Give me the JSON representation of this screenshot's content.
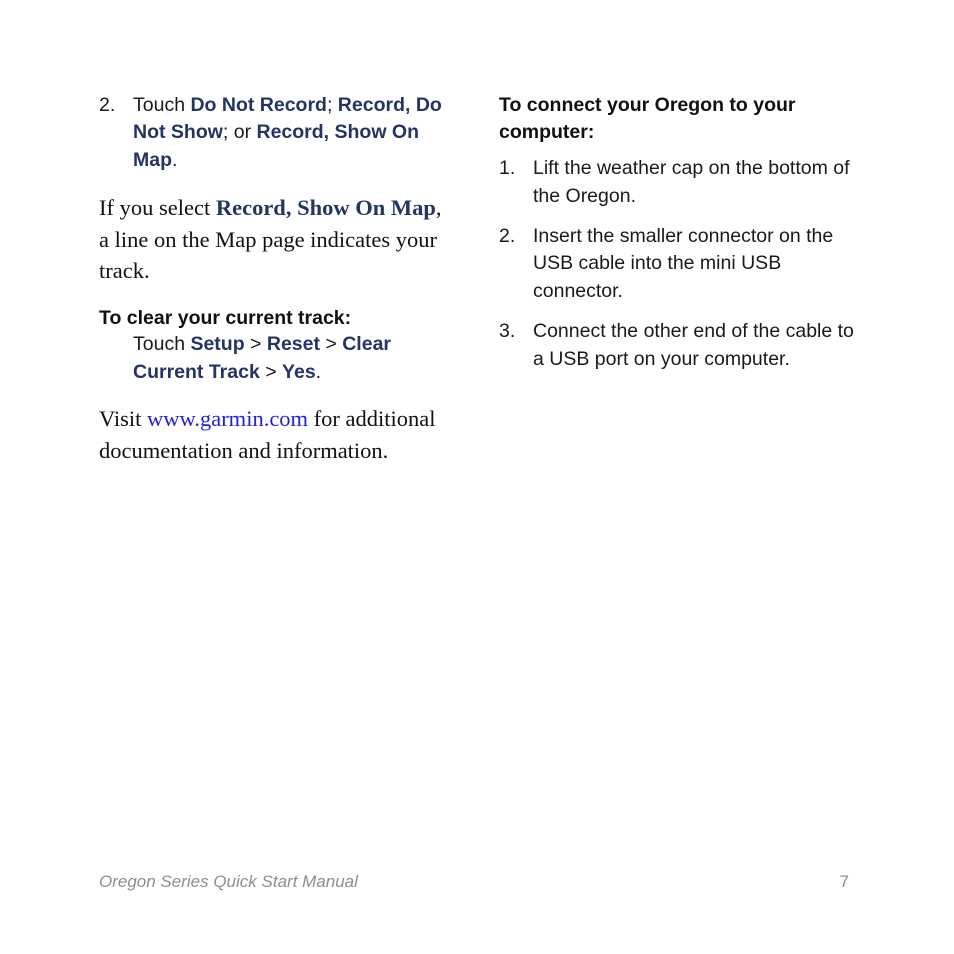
{
  "document": {
    "title": "Oregon Series Quick Start Manual",
    "page_number": "7"
  },
  "colors": {
    "nav_bold": "#233663",
    "link": "#1f1fd8",
    "footer_gray": "#8e8e8e",
    "body_text": "#1a1a1a",
    "background": "#ffffff"
  },
  "left_column": {
    "step2": {
      "number": "2.",
      "lead": "Touch ",
      "option1": "Do Not Record",
      "sep1": "; ",
      "option2": "Record, Do Not Show",
      "sep2": "; or ",
      "option3": "Record, Show On Map",
      "period": "."
    },
    "paragraph": {
      "part1": "If you select ",
      "emphasis": "Record, Show On Map",
      "part2": ", a line on the Map page indicates your track."
    },
    "clear_track": {
      "heading": "To clear your current track:",
      "lead": "Touch ",
      "step_a": "Setup",
      "arrow1": " > ",
      "step_b": "Reset",
      "arrow2": " > ",
      "step_c": "Clear Current Track",
      "arrow3": " > ",
      "step_d": "Yes",
      "period": "."
    },
    "visit": {
      "part1": "Visit ",
      "url": "www.garmin.com",
      "part2": " for additional documentation and information."
    }
  },
  "right_column": {
    "heading": "To connect your Oregon to your computer:",
    "steps": [
      {
        "number": "1.",
        "text": "Lift the weather cap on the bottom of the Oregon."
      },
      {
        "number": "2.",
        "text": "Insert the smaller connector on the USB cable into the mini USB connector."
      },
      {
        "number": "3.",
        "text": "Connect the other end of the cable to a USB port on your computer."
      }
    ]
  }
}
